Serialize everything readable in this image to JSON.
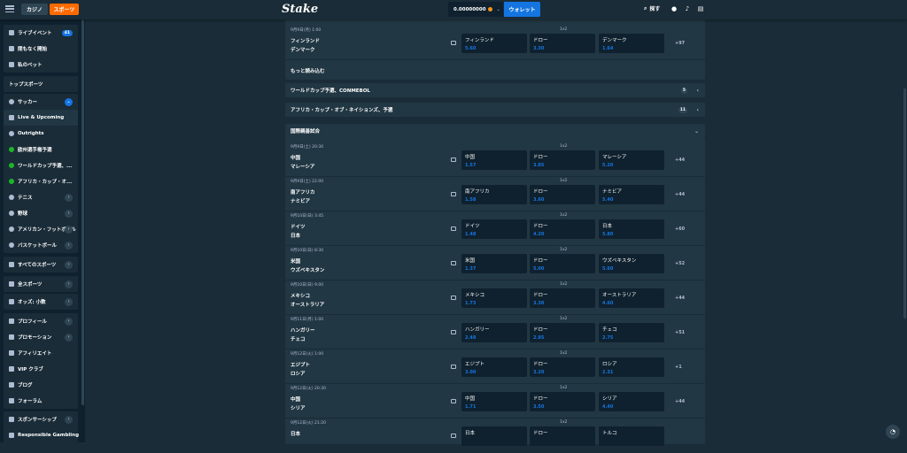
{
  "topbar": {
    "tab_casino": "カジノ",
    "tab_sports": "スポーツ",
    "logo": "Stake",
    "balance": "0.00000000",
    "wallet": "ウォレット",
    "search": "探す"
  },
  "sidebar": {
    "g1": [
      {
        "label": "ライブイベント",
        "badge": "41"
      },
      {
        "label": "間もなく開始"
      },
      {
        "label": "私のベット"
      }
    ],
    "g2": [
      {
        "label": "トップスポーツ"
      }
    ],
    "g3": [
      {
        "label": "サッカー"
      },
      {
        "label": "Live & Upcoming"
      },
      {
        "label": "Outrights"
      },
      {
        "label": "欧州選手権予選"
      },
      {
        "label": "ワールドカップ予選、..."
      },
      {
        "label": "アフリカ・カップ・オ..."
      },
      {
        "label": "テニス"
      },
      {
        "label": "野球"
      },
      {
        "label": "アメリカン・フットボール"
      },
      {
        "label": "バスケットボール"
      }
    ],
    "g4": [
      {
        "label": "すべてのスポーツ"
      }
    ],
    "g5": [
      {
        "label": "全スポーツ"
      }
    ],
    "g6": [
      {
        "label": "オッズ: 小数"
      }
    ],
    "g7": [
      {
        "label": "プロフィール"
      },
      {
        "label": "プロモーション"
      },
      {
        "label": "アフィリエイト"
      },
      {
        "label": "VIP クラブ"
      },
      {
        "label": "ブログ"
      },
      {
        "label": "フォーラム"
      }
    ],
    "g8": [
      {
        "label": "スポンサーシップ"
      },
      {
        "label": "Responsible Gambling"
      }
    ]
  },
  "top_match": {
    "date": "9月9日(月) 1:00",
    "market": "1x2",
    "team1": "フィンランド",
    "team2": "デンマーク",
    "odds": [
      {
        "name": "フィンランド",
        "price": "5.60"
      },
      {
        "name": "ドロー",
        "price": "3.30"
      },
      {
        "name": "デンマーク",
        "price": "1.64"
      }
    ],
    "more": "+97",
    "load_more": "もっと読み込む"
  },
  "sections": [
    {
      "title": "ワールドカップ予選、CONMEBOL",
      "count": "5",
      "arrow": "‹"
    },
    {
      "title": "アフリカ・カップ・オブ・ネイションズ、予選",
      "count": "11",
      "arrow": "‹"
    },
    {
      "title": "国際親善試合",
      "arrow": "⌄"
    }
  ],
  "matches": [
    {
      "date": "9月9日(土) 20:30",
      "market": "1x2",
      "team1": "中国",
      "team2": "マレーシア",
      "more": "+44",
      "odds": [
        {
          "name": "中国",
          "price": "1.57"
        },
        {
          "name": "ドロー",
          "price": "3.85"
        },
        {
          "name": "マレーシア",
          "price": "5.20"
        }
      ]
    },
    {
      "date": "9月9日(土) 22:00",
      "market": "1x2",
      "team1": "南アフリカ",
      "team2": "ナミビア",
      "more": "+44",
      "odds": [
        {
          "name": "南アフリカ",
          "price": "1.58"
        },
        {
          "name": "ドロー",
          "price": "3.60"
        },
        {
          "name": "ナミビア",
          "price": "5.40"
        }
      ]
    },
    {
      "date": "9月10日(日) 3:45",
      "market": "1x2",
      "team1": "ドイツ",
      "team2": "日本",
      "more": "+60",
      "odds": [
        {
          "name": "ドイツ",
          "price": "1.48"
        },
        {
          "name": "ドロー",
          "price": "4.20"
        },
        {
          "name": "日本",
          "price": "5.80"
        }
      ]
    },
    {
      "date": "9月10日(日) 8:30",
      "market": "1x2",
      "team1": "米国",
      "team2": "ウズベキスタン",
      "more": "+52",
      "odds": [
        {
          "name": "米国",
          "price": "1.37"
        },
        {
          "name": "ドロー",
          "price": "5.00"
        },
        {
          "name": "ウズベキスタン",
          "price": "5.60"
        }
      ]
    },
    {
      "date": "9月10日(日) 9:00",
      "market": "1x2",
      "team1": "メキシコ",
      "team2": "オーストラリア",
      "more": "+44",
      "odds": [
        {
          "name": "メキシコ",
          "price": "1.73"
        },
        {
          "name": "ドロー",
          "price": "3.30"
        },
        {
          "name": "オーストラリア",
          "price": "4.60"
        }
      ]
    },
    {
      "date": "9月11日(月) 1:00",
      "market": "1x2",
      "team1": "ハンガリー",
      "team2": "チェコ",
      "more": "+51",
      "odds": [
        {
          "name": "ハンガリー",
          "price": "2.48"
        },
        {
          "name": "ドロー",
          "price": "2.95"
        },
        {
          "name": "チェコ",
          "price": "2.75"
        }
      ]
    },
    {
      "date": "9月12日(火) 1:00",
      "market": "1x2",
      "team1": "エジプト",
      "team2": "ロシア",
      "more": "+1",
      "odds": [
        {
          "name": "エジプト",
          "price": "3.00"
        },
        {
          "name": "ドロー",
          "price": "3.20"
        },
        {
          "name": "ロシア",
          "price": "2.31"
        }
      ]
    },
    {
      "date": "9月12日(火) 20:30",
      "market": "1x2",
      "team1": "中国",
      "team2": "シリア",
      "more": "+44",
      "odds": [
        {
          "name": "中国",
          "price": "1.71"
        },
        {
          "name": "ドロー",
          "price": "3.50"
        },
        {
          "name": "シリア",
          "price": "4.40"
        }
      ]
    },
    {
      "date": "9月12日(火) 21:20",
      "market": "1x2",
      "team1": "日本",
      "team2": "",
      "more": "",
      "odds": [
        {
          "name": "日本",
          "price": ""
        },
        {
          "name": "ドロー",
          "price": ""
        },
        {
          "name": "トルコ",
          "price": ""
        }
      ]
    }
  ]
}
